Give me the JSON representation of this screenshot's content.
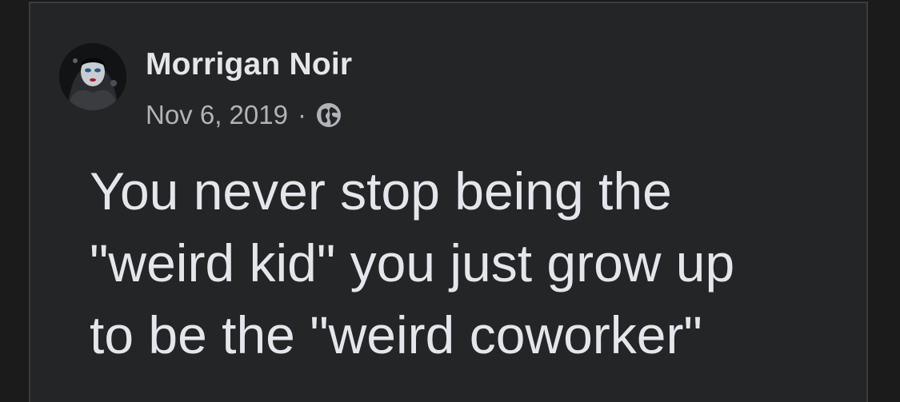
{
  "post": {
    "author_name": "Morrigan Noir",
    "date": "Nov 6, 2019",
    "separator": "·",
    "audience_icon": "globe-icon",
    "text_lines": [
      "You never stop being the",
      "\"weird kid\" you just grow up",
      "to be the \"weird coworker\""
    ],
    "avatar_icon": "profile-photo"
  },
  "colors": {
    "background": "#1b1b1c",
    "card": "#242526",
    "primary_text": "#e4e6eb",
    "secondary_text": "#b0b3b8"
  }
}
